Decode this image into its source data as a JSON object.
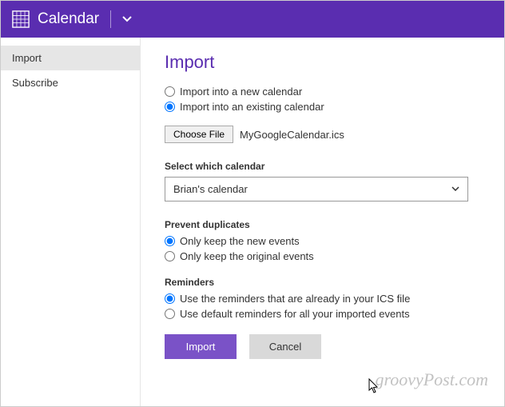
{
  "header": {
    "title": "Calendar"
  },
  "sidebar": {
    "items": [
      {
        "label": "Import",
        "active": true
      },
      {
        "label": "Subscribe",
        "active": false
      }
    ]
  },
  "main": {
    "heading": "Import",
    "importMode": {
      "options": [
        {
          "label": "Import into a new calendar",
          "checked": false
        },
        {
          "label": "Import into an existing calendar",
          "checked": true
        }
      ]
    },
    "file": {
      "buttonLabel": "Choose File",
      "fileName": "MyGoogleCalendar.ics"
    },
    "calendarSelect": {
      "label": "Select which calendar",
      "value": "Brian's calendar"
    },
    "duplicates": {
      "label": "Prevent duplicates",
      "options": [
        {
          "label": "Only keep the new events",
          "checked": true
        },
        {
          "label": "Only keep the original events",
          "checked": false
        }
      ]
    },
    "reminders": {
      "label": "Reminders",
      "options": [
        {
          "label": "Use the reminders that are already in your ICS file",
          "checked": true
        },
        {
          "label": "Use default reminders for all your imported events",
          "checked": false
        }
      ]
    },
    "buttons": {
      "primary": "Import",
      "secondary": "Cancel"
    }
  },
  "watermark": "groovyPost.com"
}
